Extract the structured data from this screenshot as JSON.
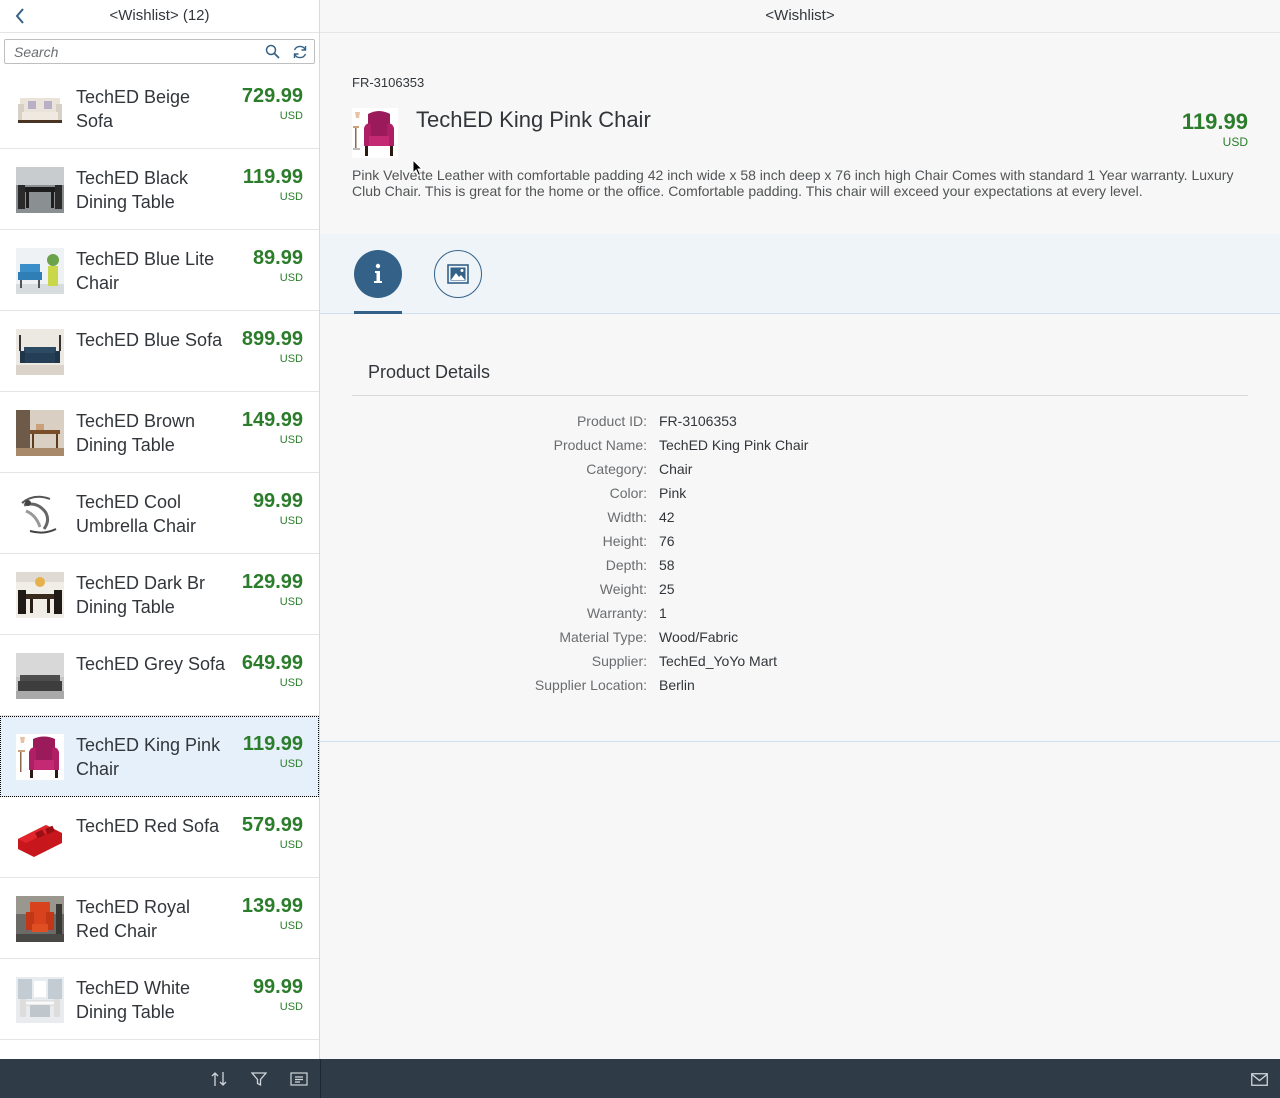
{
  "master": {
    "title": "<Wishlist> (12)",
    "search": {
      "placeholder": "Search",
      "value": ""
    },
    "items": [
      {
        "title": "TechED Beige Sofa",
        "price": "729.99",
        "currency": "USD",
        "thumb": "beige-sofa"
      },
      {
        "title": "TechED Black Dining Table",
        "price": "119.99",
        "currency": "USD",
        "thumb": "black-table"
      },
      {
        "title": "TechED Blue Lite Chair",
        "price": "89.99",
        "currency": "USD",
        "thumb": "blue-chair"
      },
      {
        "title": "TechED Blue Sofa",
        "price": "899.99",
        "currency": "USD",
        "thumb": "blue-sofa"
      },
      {
        "title": "TechED Brown Dining Table",
        "price": "149.99",
        "currency": "USD",
        "thumb": "brown-table"
      },
      {
        "title": "TechED Cool Umbrella Chair",
        "price": "99.99",
        "currency": "USD",
        "thumb": "umbrella-chair"
      },
      {
        "title": "TechED Dark Br Dining Table",
        "price": "129.99",
        "currency": "USD",
        "thumb": "darkbr-table"
      },
      {
        "title": "TechED Grey Sofa",
        "price": "649.99",
        "currency": "USD",
        "thumb": "grey-sofa"
      },
      {
        "title": "TechED King Pink Chair",
        "price": "119.99",
        "currency": "USD",
        "thumb": "pink-chair",
        "selected": true
      },
      {
        "title": "TechED Red Sofa",
        "price": "579.99",
        "currency": "USD",
        "thumb": "red-sofa"
      },
      {
        "title": "TechED Royal Red Chair",
        "price": "139.99",
        "currency": "USD",
        "thumb": "red-chair"
      },
      {
        "title": "TechED White Dining Table",
        "price": "99.99",
        "currency": "USD",
        "thumb": "white-table"
      }
    ],
    "footer_icons": [
      "sort-icon",
      "filter-icon",
      "group-icon"
    ]
  },
  "detail": {
    "title": "<Wishlist>",
    "object": {
      "id": "FR-3106353",
      "title": "TechED King Pink Chair",
      "price": "119.99",
      "currency": "USD",
      "description": "Pink Velvette Leather with comfortable padding 42 inch wide x 58 inch deep x 76 inch high Chair Comes with standard 1 Year warranty. Luxury Club Chair. This is great for the home or the office. Comfortable padding. This chair will exceed your expectations at every level."
    },
    "tabs": [
      {
        "icon": "info-icon",
        "selected": true
      },
      {
        "icon": "image-icon",
        "selected": false
      }
    ],
    "form": {
      "title": "Product Details",
      "rows": [
        {
          "label": "Product ID:",
          "value": "FR-3106353"
        },
        {
          "label": "Product Name:",
          "value": "TechED King Pink Chair"
        },
        {
          "label": "Category:",
          "value": "Chair"
        },
        {
          "label": "Color:",
          "value": "Pink"
        },
        {
          "label": "Width:",
          "value": "42"
        },
        {
          "label": "Height:",
          "value": "76"
        },
        {
          "label": "Depth:",
          "value": "58"
        },
        {
          "label": "Weight:",
          "value": "25"
        },
        {
          "label": "Warranty:",
          "value": "1"
        },
        {
          "label": "Material Type:",
          "value": "Wood/Fabric"
        },
        {
          "label": "Supplier:",
          "value": "TechEd_YoYo Mart"
        },
        {
          "label": "Supplier Location:",
          "value": "Berlin"
        }
      ]
    },
    "footer_icons": [
      "email-icon"
    ]
  },
  "colors": {
    "price_green": "#2b7d2b",
    "accent_blue": "#346187",
    "footer_dark": "#2f3c48",
    "selected_row": "#e5f0fa"
  }
}
